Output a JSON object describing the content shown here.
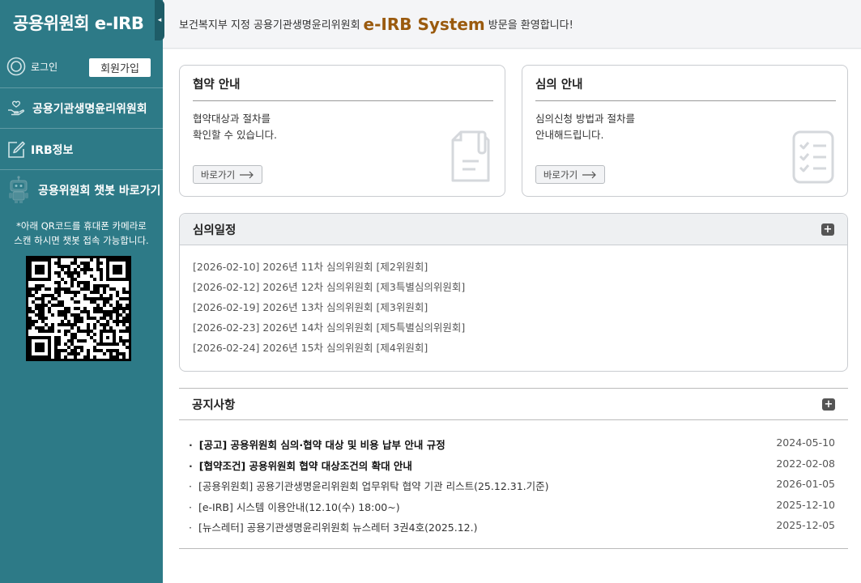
{
  "sidebar": {
    "brand": "공용위원회 e-IRB",
    "collapse_glyph": "◂",
    "login_label": "로그인",
    "join_label": "회원가입",
    "menu": [
      {
        "label": "공용기관생명윤리위원회",
        "icon": "hand-heart-icon"
      },
      {
        "label": "IRB정보",
        "icon": "edit-icon"
      },
      {
        "label": "공용위원회 챗봇 바로가기",
        "icon": "robot-icon"
      }
    ],
    "qr_note_1": "*아래 QR코드를 휴대폰 카메라로",
    "qr_note_2": "스캔 하시면 챗봇 접속 가능합니다."
  },
  "topbar": {
    "prefix": "보건복지부 지정 공용기관생명윤리위원회",
    "system": "e-IRB System",
    "suffix": "방문을 환영합니다!"
  },
  "cards": [
    {
      "title": "협약 안내",
      "line1": "협약대상과 절차를",
      "line2": "확인할 수 있습니다.",
      "button": "바로가기",
      "icon": "document-pen-icon"
    },
    {
      "title": "심의 안내",
      "line1": "심의신청 방법과 절차를",
      "line2": "안내해드립니다.",
      "button": "바로가기",
      "icon": "checklist-icon"
    }
  ],
  "schedule": {
    "title": "심의일정",
    "items": [
      "[2026-02-10] 2026년 11차 심의위원회 [제2위원회]",
      "[2026-02-12] 2026년 12차 심의위원회 [제3특별심의위원회]",
      "[2026-02-19] 2026년 13차 심의위원회 [제3위원회]",
      "[2026-02-23] 2026년 14차 심의위원회 [제5특별심의위원회]",
      "[2026-02-24] 2026년 15차 심의위원회 [제4위원회]"
    ]
  },
  "notice": {
    "title": "공지사항",
    "items": [
      {
        "title": "[공고] 공용위원회 심의·협약 대상 및 비용 납부 안내 규정",
        "date": "2024-05-10",
        "bold": true
      },
      {
        "title": "[협약조건] 공용위원회 협약 대상조건의 확대 안내",
        "date": "2022-02-08",
        "bold": true
      },
      {
        "title": "[공용위원회] 공용기관생명윤리위원회 업무위탁 협약 기관 리스트(25.12.31.기준)",
        "date": "2026-01-05",
        "bold": false
      },
      {
        "title": "[e-IRB] 시스템 이용안내(12.10(수) 18:00~)",
        "date": "2025-12-10",
        "bold": false
      },
      {
        "title": "[뉴스레터] 공용기관생명윤리위원회 뉴스레터 3권4호(2025.12.)",
        "date": "2025-12-05",
        "bold": false
      }
    ]
  },
  "colors": {
    "sidebar": "#2d7a87",
    "brand_accent": "#9a5a0e"
  }
}
